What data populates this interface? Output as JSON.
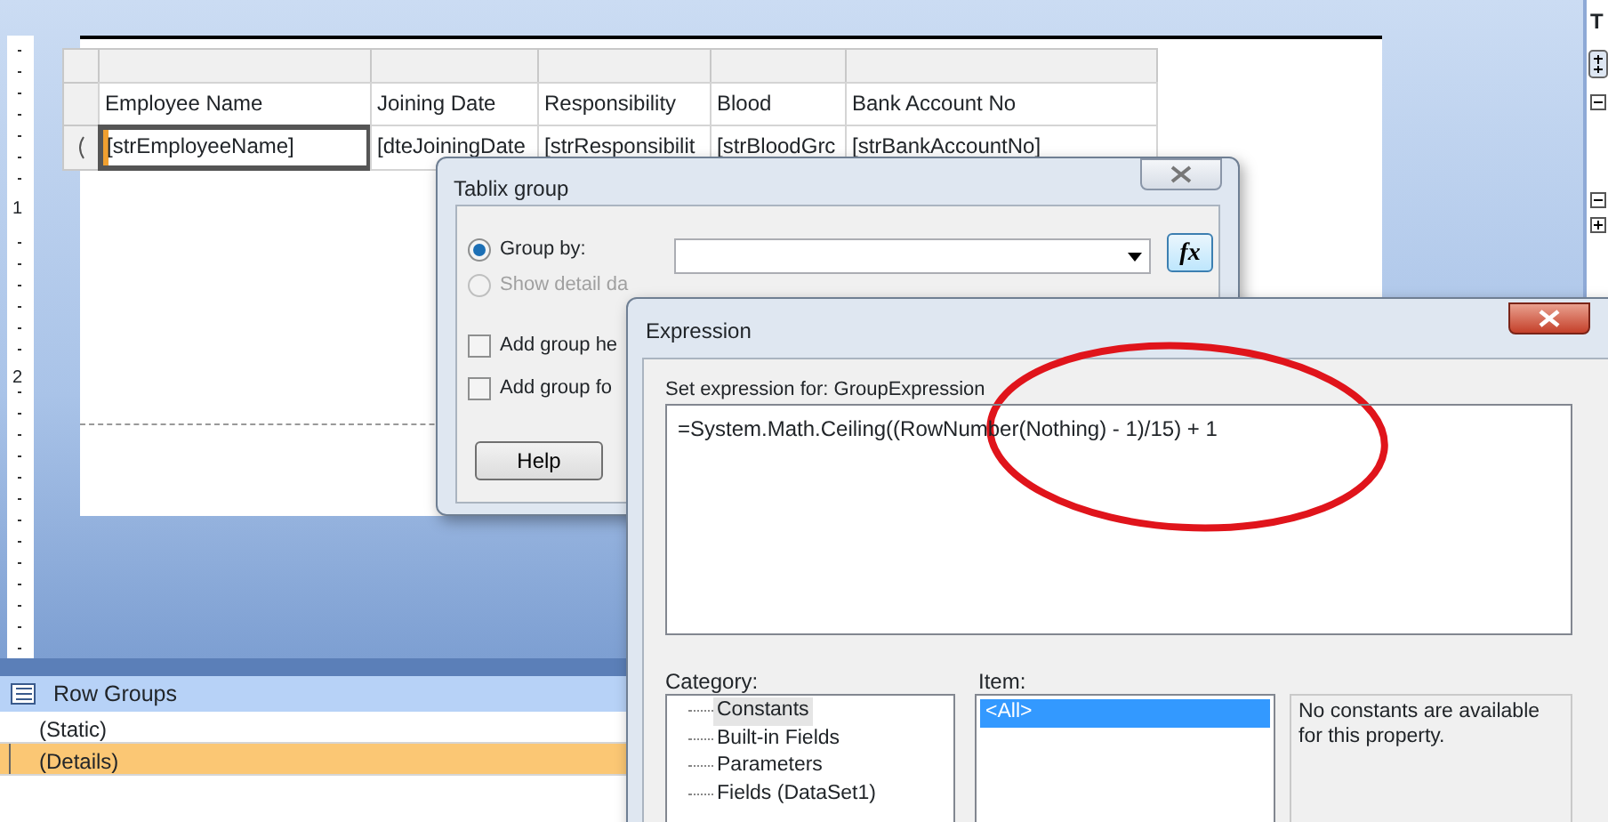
{
  "ruler": {
    "marks": [
      "1",
      "2"
    ]
  },
  "report": {
    "header_cells": [
      "Employee Name",
      "Joining Date",
      "Responsibility",
      "Blood",
      "Bank Account No"
    ],
    "data_cells": [
      {
        "text": "[strEmployeeName]",
        "selected": true
      },
      {
        "text": "[dteJoiningDate",
        "selected": false
      },
      {
        "text": "[strResponsibilit",
        "selected": false
      },
      {
        "text": "[strBloodGrc",
        "selected": false
      },
      {
        "text": "[strBankAccountNo]",
        "selected": false
      }
    ]
  },
  "row_groups": {
    "title": "Row Groups",
    "items": [
      {
        "label": "(Static)",
        "selected": false
      },
      {
        "label": "(Details)",
        "selected": true
      }
    ]
  },
  "side_panel": {
    "title": "T"
  },
  "tablix_group_dialog": {
    "title": "Tablix group",
    "fx_button": "fx",
    "options": [
      {
        "kind": "radio",
        "label": "Group by:",
        "checked": true,
        "disabled": false
      },
      {
        "kind": "radio",
        "label": "Show detail da",
        "checked": false,
        "disabled": true
      },
      {
        "kind": "checkbox",
        "label": "Add group he",
        "checked": false,
        "disabled": false
      },
      {
        "kind": "checkbox",
        "label": "Add group fo",
        "checked": false,
        "disabled": false
      }
    ],
    "help_button": "Help"
  },
  "expression_dialog": {
    "title": "Expression",
    "prompt": "Set expression for: GroupExpression",
    "expression": "=System.Math.Ceiling((RowNumber(Nothing) - 1)/15) + 1",
    "category_label": "Category:",
    "categories": [
      {
        "label": "Constants",
        "selected": true
      },
      {
        "label": "Built-in Fields",
        "selected": false
      },
      {
        "label": "Parameters",
        "selected": false
      },
      {
        "label": "Fields (DataSet1)",
        "selected": false
      }
    ],
    "item_label": "Item:",
    "items": [
      {
        "label": "<All>",
        "selected": true
      }
    ],
    "description": "No constants are available for this property."
  }
}
